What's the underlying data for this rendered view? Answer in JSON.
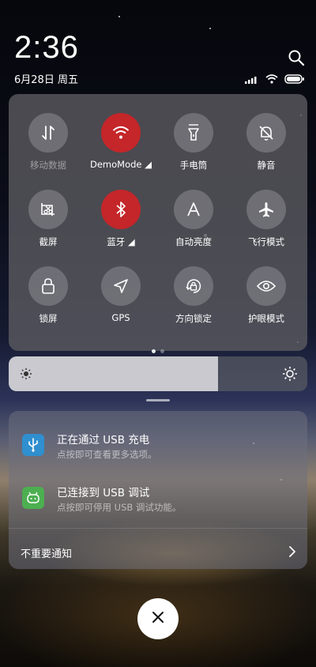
{
  "status": {
    "time": "2:36",
    "date": "6月28日 周五"
  },
  "quick_tiles": [
    {
      "label": "移动数据",
      "icon": "mobile-data-icon",
      "active": false,
      "dim": true
    },
    {
      "label": "DemoMode ◢",
      "icon": "wifi-icon",
      "active": true,
      "dim": false
    },
    {
      "label": "手电筒",
      "icon": "flashlight-icon",
      "active": false,
      "dim": false
    },
    {
      "label": "静音",
      "icon": "mute-bell-icon",
      "active": false,
      "dim": false
    },
    {
      "label": "截屏",
      "icon": "screenshot-icon",
      "active": false,
      "dim": false
    },
    {
      "label": "蓝牙 ◢",
      "icon": "bluetooth-icon",
      "active": true,
      "dim": false
    },
    {
      "label": "自动亮度",
      "icon": "auto-brightness-icon",
      "active": false,
      "dim": false
    },
    {
      "label": "飞行模式",
      "icon": "airplane-icon",
      "active": false,
      "dim": false
    },
    {
      "label": "锁屏",
      "icon": "lock-icon",
      "active": false,
      "dim": false
    },
    {
      "label": "GPS",
      "icon": "location-icon",
      "active": false,
      "dim": false
    },
    {
      "label": "方向锁定",
      "icon": "rotation-lock-icon",
      "active": false,
      "dim": false
    },
    {
      "label": "护眼模式",
      "icon": "eye-icon",
      "active": false,
      "dim": false
    }
  ],
  "brightness": {
    "level": 0.7
  },
  "notifications": [
    {
      "title": "正在通过 USB 充电",
      "subtitle": "点按即可查看更多选项。",
      "icon": "usb-icon",
      "color": "#2f8fcf"
    },
    {
      "title": "已连接到 USB 调试",
      "subtitle": "点按即可停用 USB 调试功能。",
      "icon": "android-debug-icon",
      "color": "#4caf50"
    }
  ],
  "footer": {
    "more_label": "不重要通知"
  },
  "colors": {
    "active_tile": "#c4262a"
  }
}
